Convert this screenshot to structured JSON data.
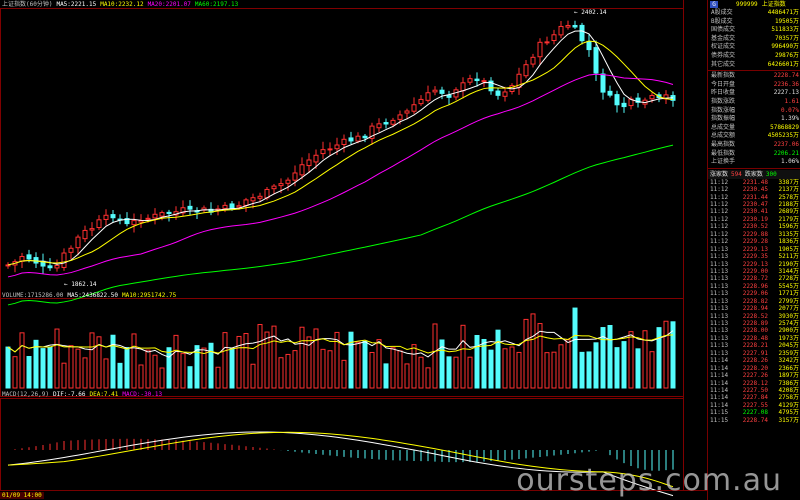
{
  "colors": {
    "up": "#ff3030",
    "down": "#54fcfc",
    "ma5": "#ffffff",
    "ma10": "#ffff00",
    "ma20": "#ff00ff",
    "ma60": "#00ff00",
    "grid": "#800000"
  },
  "header": {
    "title": "上证指数(60分钟)",
    "ma5": "MA5:2221.15",
    "ma10": "MA10:2232.12",
    "ma20": "MA20:2201.07",
    "ma60": "MA60:2197.13"
  },
  "volume_header": {
    "title": "VOLUME:1715286.00",
    "ma5": "MA5:2436822.50",
    "ma10": "MA10:2951742.75"
  },
  "macd_header": {
    "title": "MACD(12,26,9)",
    "dif": "DIF:-7.66",
    "dea": "DEA:7.41",
    "macd": "MACD:-30.13"
  },
  "annotations": {
    "high": "2402.14",
    "low": "1862.14"
  },
  "axis": {
    "start_label": "01/09 14:00"
  },
  "watermark": "oursteps.com.au",
  "panel": {
    "icon": "G",
    "code": "999999",
    "name": "上证指数",
    "stats": [
      {
        "label": "A股成交",
        "value": "4486471万",
        "cls": "yel"
      },
      {
        "label": "B股成交",
        "value": "19505万",
        "cls": "yel"
      },
      {
        "label": "国债成交",
        "value": "511833万",
        "cls": "yel"
      },
      {
        "label": "基金成交",
        "value": "70357万",
        "cls": "yel"
      },
      {
        "label": "权证成交",
        "value": "996490万",
        "cls": "yel"
      },
      {
        "label": "债券成交",
        "value": "29876万",
        "cls": "yel"
      },
      {
        "label": "其它成交",
        "value": "6426601万",
        "cls": "yel"
      }
    ],
    "quote": [
      {
        "label": "最新指数",
        "value": "2228.74",
        "cls": "red"
      },
      {
        "label": "今日开盘",
        "value": "2236.36",
        "cls": "red"
      },
      {
        "label": "昨日收盘",
        "value": "2227.13",
        "cls": "wht"
      },
      {
        "label": "指数涨跌",
        "value": "1.61",
        "cls": "red"
      },
      {
        "label": "指数涨幅",
        "value": "0.07%",
        "cls": "red"
      },
      {
        "label": "指数振幅",
        "value": "1.39%",
        "cls": "wht"
      },
      {
        "label": "总成交量",
        "value": "57868829",
        "cls": "yel"
      },
      {
        "label": "总成交额",
        "value": "4505235万",
        "cls": "yel"
      },
      {
        "label": "最高指数",
        "value": "2237.06",
        "cls": "red"
      },
      {
        "label": "最低指数",
        "value": "2206.21",
        "cls": "grn"
      },
      {
        "label": "上证换手",
        "value": "1.06%",
        "cls": "wht"
      }
    ],
    "updown": {
      "up_label": "涨家数",
      "up": "594",
      "down_label": "跌家数",
      "down": "300"
    },
    "ticks": [
      {
        "t": "11:12",
        "p": "2231.48",
        "v": "3387万",
        "cls": "red"
      },
      {
        "t": "11:12",
        "p": "2230.45",
        "v": "2137万",
        "cls": "red"
      },
      {
        "t": "11:12",
        "p": "2231.44",
        "v": "2578万",
        "cls": "red"
      },
      {
        "t": "11:12",
        "p": "2230.47",
        "v": "2188万",
        "cls": "red"
      },
      {
        "t": "11:12",
        "p": "2230.41",
        "v": "2689万",
        "cls": "red"
      },
      {
        "t": "11:12",
        "p": "2230.19",
        "v": "2179万",
        "cls": "red"
      },
      {
        "t": "11:12",
        "p": "2230.52",
        "v": "1596万",
        "cls": "red"
      },
      {
        "t": "11:12",
        "p": "2229.88",
        "v": "3135万",
        "cls": "red"
      },
      {
        "t": "11:12",
        "p": "2229.28",
        "v": "1836万",
        "cls": "red"
      },
      {
        "t": "11:13",
        "p": "2229.13",
        "v": "1905万",
        "cls": "red"
      },
      {
        "t": "11:13",
        "p": "2229.35",
        "v": "5211万",
        "cls": "red"
      },
      {
        "t": "11:13",
        "p": "2229.13",
        "v": "2190万",
        "cls": "red"
      },
      {
        "t": "11:13",
        "p": "2229.00",
        "v": "3144万",
        "cls": "red"
      },
      {
        "t": "11:13",
        "p": "2228.72",
        "v": "2728万",
        "cls": "red"
      },
      {
        "t": "11:13",
        "p": "2228.96",
        "v": "5545万",
        "cls": "red"
      },
      {
        "t": "11:13",
        "p": "2229.06",
        "v": "1771万",
        "cls": "red"
      },
      {
        "t": "11:13",
        "p": "2228.82",
        "v": "2799万",
        "cls": "red"
      },
      {
        "t": "11:13",
        "p": "2228.94",
        "v": "2077万",
        "cls": "red"
      },
      {
        "t": "11:13",
        "p": "2228.52",
        "v": "3930万",
        "cls": "red"
      },
      {
        "t": "11:13",
        "p": "2228.89",
        "v": "2574万",
        "cls": "red"
      },
      {
        "t": "11:13",
        "p": "2228.00",
        "v": "2900万",
        "cls": "red"
      },
      {
        "t": "11:13",
        "p": "2228.48",
        "v": "1973万",
        "cls": "red"
      },
      {
        "t": "11:13",
        "p": "2228.21",
        "v": "2045万",
        "cls": "red"
      },
      {
        "t": "11:13",
        "p": "2227.91",
        "v": "2359万",
        "cls": "red"
      },
      {
        "t": "11:14",
        "p": "2228.26",
        "v": "3242万",
        "cls": "red"
      },
      {
        "t": "11:14",
        "p": "2228.20",
        "v": "2366万",
        "cls": "red"
      },
      {
        "t": "11:14",
        "p": "2227.26",
        "v": "1897万",
        "cls": "red"
      },
      {
        "t": "11:14",
        "p": "2228.12",
        "v": "7386万",
        "cls": "red"
      },
      {
        "t": "11:14",
        "p": "2227.50",
        "v": "4208万",
        "cls": "red"
      },
      {
        "t": "11:14",
        "p": "2227.84",
        "v": "2758万",
        "cls": "red"
      },
      {
        "t": "11:14",
        "p": "2227.55",
        "v": "4129万",
        "cls": "red"
      },
      {
        "t": "11:15",
        "p": "2227.08",
        "v": "4795万",
        "cls": "grn"
      },
      {
        "t": "11:15",
        "p": "2228.74",
        "v": "3157万",
        "cls": "red"
      }
    ]
  }
}
